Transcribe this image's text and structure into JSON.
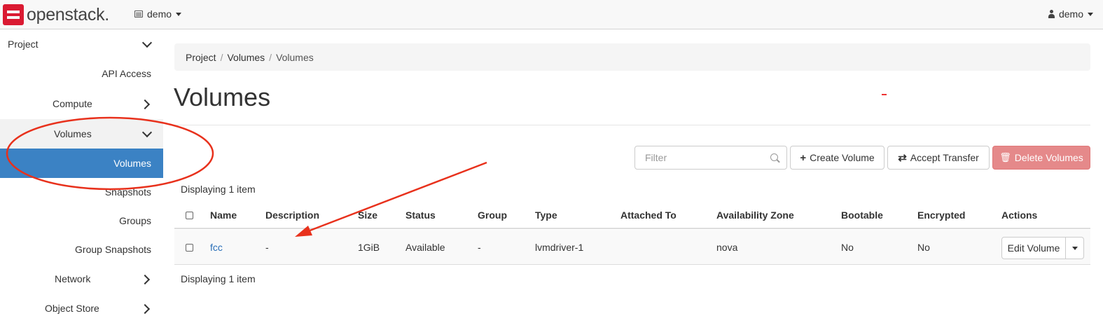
{
  "topbar": {
    "logo_text": "openstack.",
    "project_label": "demo",
    "user_label": "demo"
  },
  "sidebar": {
    "items": [
      {
        "label": "Project"
      },
      {
        "label": "API Access"
      },
      {
        "label": "Compute"
      },
      {
        "label": "Volumes"
      },
      {
        "label": "Volumes"
      },
      {
        "label": "Snapshots"
      },
      {
        "label": "Groups"
      },
      {
        "label": "Group Snapshots"
      },
      {
        "label": "Network"
      },
      {
        "label": "Object Store"
      }
    ]
  },
  "breadcrumb": [
    "Project",
    "Volumes",
    "Volumes"
  ],
  "breadcrumb_sep": "/",
  "page_title": "Volumes",
  "toolbar": {
    "filter_placeholder": "Filter",
    "create_label": "Create Volume",
    "accept_label": "Accept Transfer",
    "delete_label": "Delete Volumes"
  },
  "display_count_top": "Displaying 1 item",
  "display_count_bottom": "Displaying 1 item",
  "table": {
    "columns": [
      "Name",
      "Description",
      "Size",
      "Status",
      "Group",
      "Type",
      "Attached To",
      "Availability Zone",
      "Bootable",
      "Encrypted",
      "Actions"
    ],
    "rows": [
      {
        "name": "fcc",
        "description": "-",
        "size": "1GiB",
        "status": "Available",
        "group": "-",
        "type": "lvmdriver-1",
        "attached_to": "",
        "availability_zone": "nova",
        "bootable": "No",
        "encrypted": "No",
        "action": "Edit Volume"
      }
    ]
  },
  "colors": {
    "accent": "#3b82c4",
    "danger": "#e5898a",
    "annotation": "#e8311c",
    "link": "#2a6fb8"
  }
}
